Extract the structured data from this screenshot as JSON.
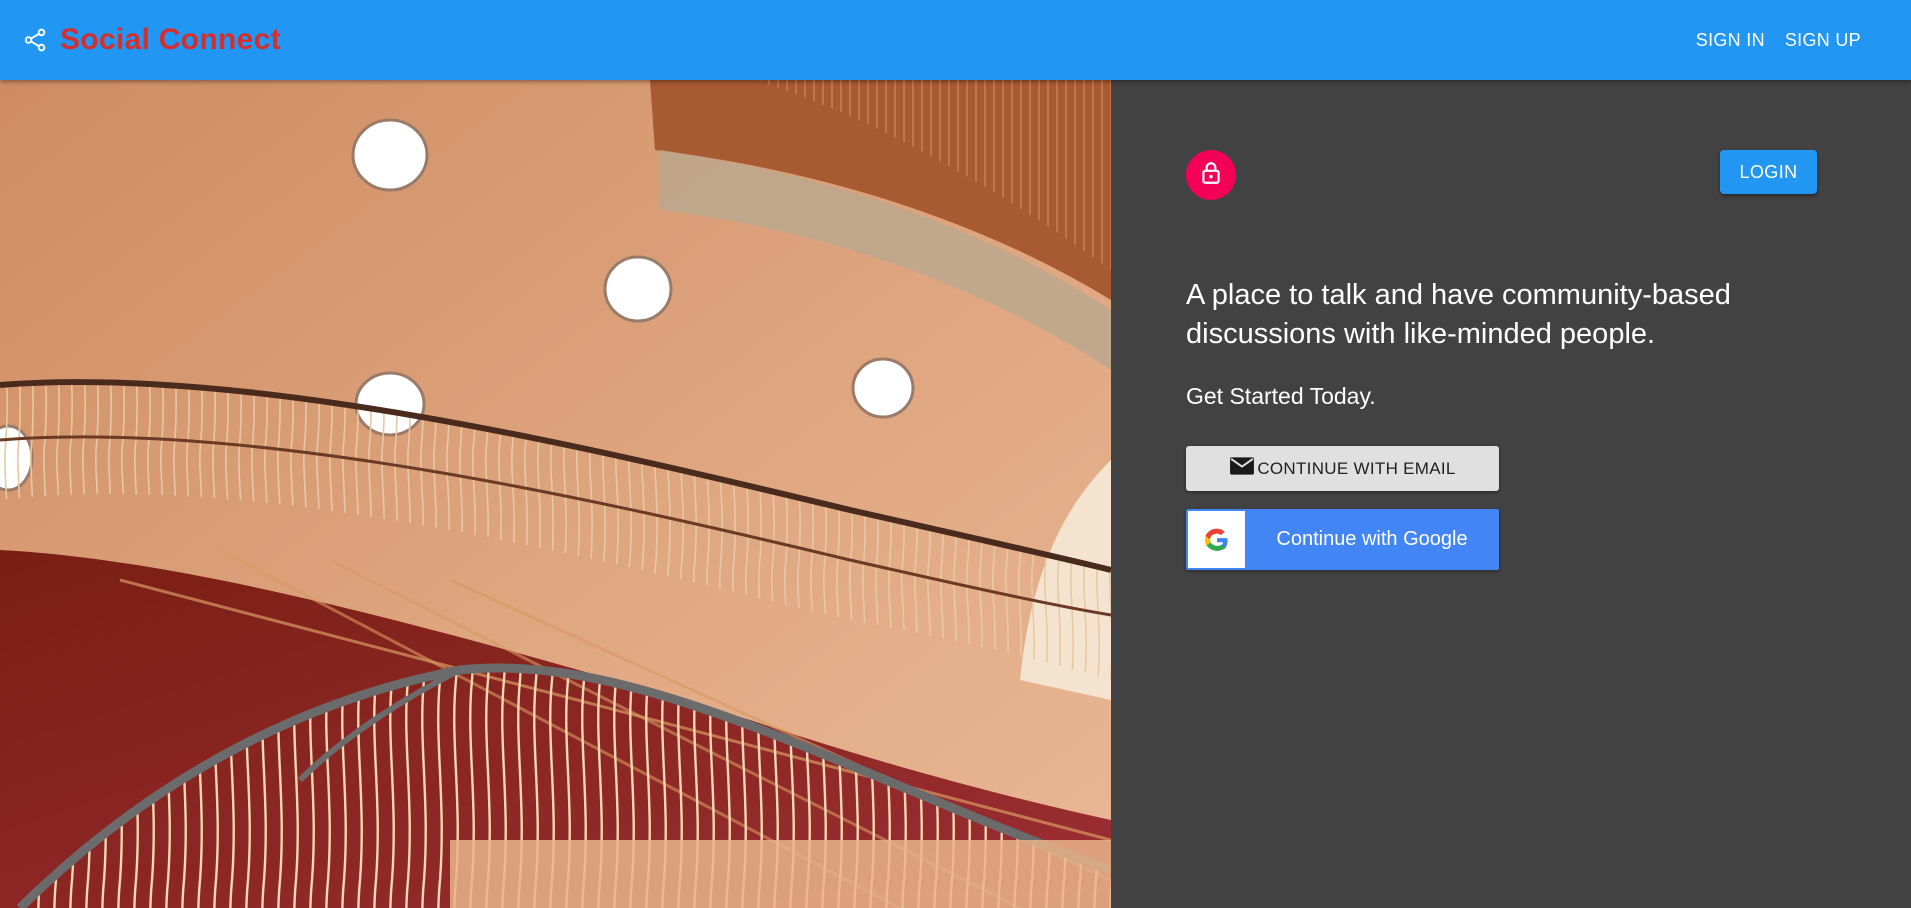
{
  "appbar": {
    "title": "Social Connect",
    "brand_icon": "share-icon",
    "nav": [
      {
        "label": "SIGN IN"
      },
      {
        "label": "SIGN UP"
      }
    ]
  },
  "hero": {
    "image": "spiral-staircase-photo"
  },
  "panel": {
    "avatar_icon": "lock-icon",
    "login_label": "LOGIN",
    "headline": "A place to talk and have community-based discussions with like-minded people.",
    "subhead": "Get Started Today.",
    "email_button_label": "CONTINUE WITH EMAIL",
    "email_icon": "mail-icon",
    "google_button_label": "Continue with Google",
    "google_icon": "google-g-icon"
  },
  "colors": {
    "appbar": "#2196f3",
    "brand_title": "#d32f2f",
    "panel_bg": "#424242",
    "avatar": "#f50057",
    "google_blue": "#4285f4",
    "email_button": "#e0e0e0"
  }
}
